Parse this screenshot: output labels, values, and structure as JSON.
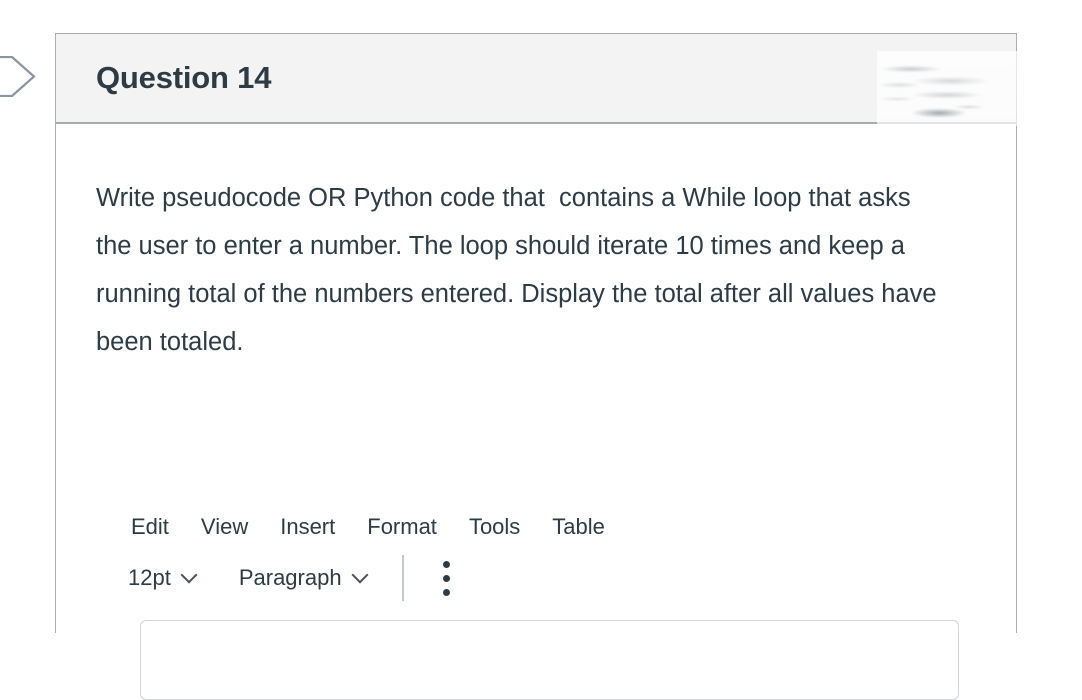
{
  "page": {
    "background_color": "#ffffff"
  },
  "left_flag_tab": {
    "icon": "flag-pointer-tab-icon",
    "stroke_color": "#8a97a1",
    "fill_color": "#ffffff"
  },
  "question_card": {
    "border_color": "#a8acaf",
    "header": {
      "background_color": "#f3f3f3",
      "title": "Question 14",
      "title_color": "#2d3b45",
      "points_area": {
        "icon": "redacted-smudge-icon",
        "state": "erased"
      }
    },
    "body": {
      "prompt": "Write pseudocode OR Python code that  contains a While loop that asks the user to enter a number. The loop should iterate 10 times and keep a running total of the numbers entered. Display the total after all values have been totaled.",
      "prompt_color": "#2d3b45"
    }
  },
  "editor": {
    "menubar": {
      "items": [
        {
          "label": "Edit"
        },
        {
          "label": "View"
        },
        {
          "label": "Insert"
        },
        {
          "label": "Format"
        },
        {
          "label": "Tools"
        },
        {
          "label": "Table"
        }
      ]
    },
    "toolbar": {
      "font_size": {
        "value": "12pt",
        "chevron_icon": "chevron-down-icon"
      },
      "block_format": {
        "value": "Paragraph",
        "chevron_icon": "chevron-down-icon"
      },
      "divider": true,
      "overflow": {
        "icon": "kebab-vertical-icon",
        "label": "More"
      }
    },
    "content_area": {
      "value": "",
      "placeholder": "",
      "border_color": "#d2d4d6"
    }
  }
}
